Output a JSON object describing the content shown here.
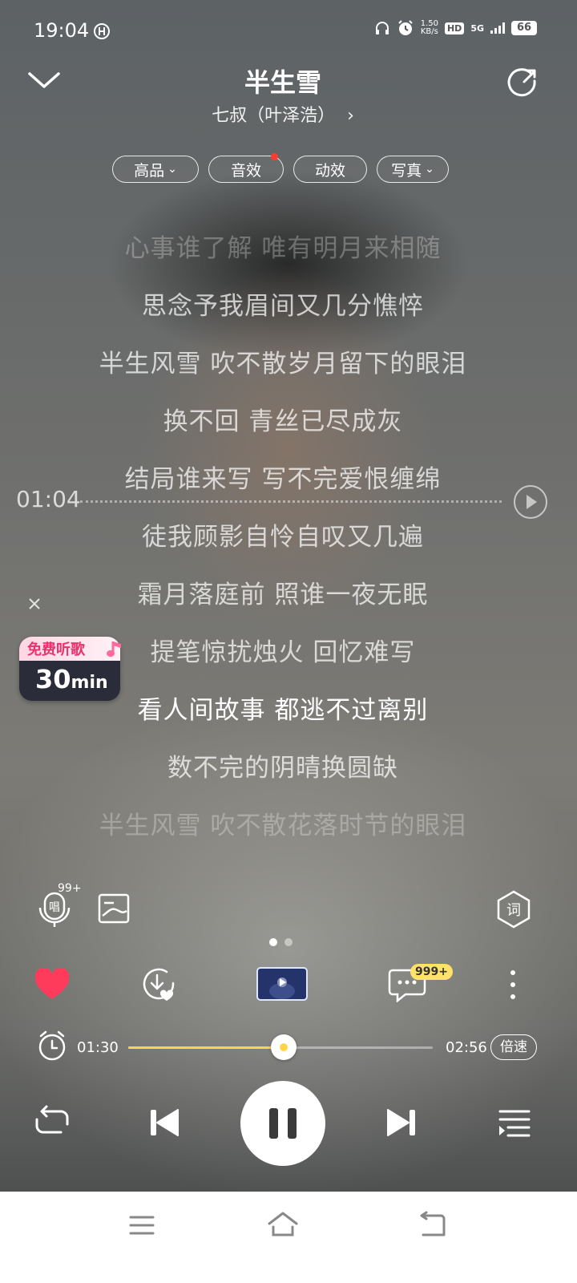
{
  "status_bar": {
    "time": "19:04",
    "net_speed_value": "1.50",
    "net_speed_unit": "KB/s",
    "hd": "HD",
    "signal": "5G",
    "battery": "66"
  },
  "header": {
    "title": "半生雪",
    "artist": "七叔（叶泽浩）",
    "artist_chevron": "›"
  },
  "pills": [
    {
      "label": "高品",
      "chevron": "⌄"
    },
    {
      "label": "音效"
    },
    {
      "label": "动效"
    },
    {
      "label": "写真",
      "chevron": "⌄"
    }
  ],
  "lyrics": [
    "心事谁了解  唯有明月来相随",
    "思念予我眉间又几分憔悴",
    "半生风雪  吹不散岁月留下的眼泪",
    "换不回  青丝已尽成灰",
    "结局谁来写  写不完爱恨缠绵",
    "徒我顾影自怜自叹又几遍",
    "霜月落庭前  照谁一夜无眠",
    "提笔惊扰烛火  回忆难写",
    "看人间故事  都逃不过离别",
    "数不完的阴晴换圆缺",
    "半生风雪  吹不散花落时节的眼泪"
  ],
  "lyrics_active_index": 8,
  "seek": {
    "time": "01:04"
  },
  "promo": {
    "label": "免费听歌",
    "value": "30",
    "unit": "min"
  },
  "tools": {
    "sing_count": "99+",
    "comment_count": "999+"
  },
  "pager": {
    "pages": 2,
    "active": 0
  },
  "player": {
    "current_time": "01:30",
    "total_time": "02:56",
    "progress": 0.51,
    "speed_label": "倍速",
    "liked": true,
    "is_playing": true
  },
  "colors": {
    "accent": "#ffd44a",
    "heart": "#ff3b5c",
    "red_dot": "#ff3b30",
    "promo_pink": "#e8336c"
  },
  "icons": {
    "collapse": "chevron-down-icon",
    "share": "share-icon",
    "like": "heart-icon",
    "download": "download-icon",
    "video": "mv-thumbnail",
    "comments": "comment-icon",
    "more": "more-vertical-icon",
    "timer": "alarm-clock-icon",
    "repeat": "repeat-icon",
    "prev": "skip-previous-icon",
    "pause": "pause-icon",
    "next": "skip-next-icon",
    "playlist": "playlist-icon"
  }
}
